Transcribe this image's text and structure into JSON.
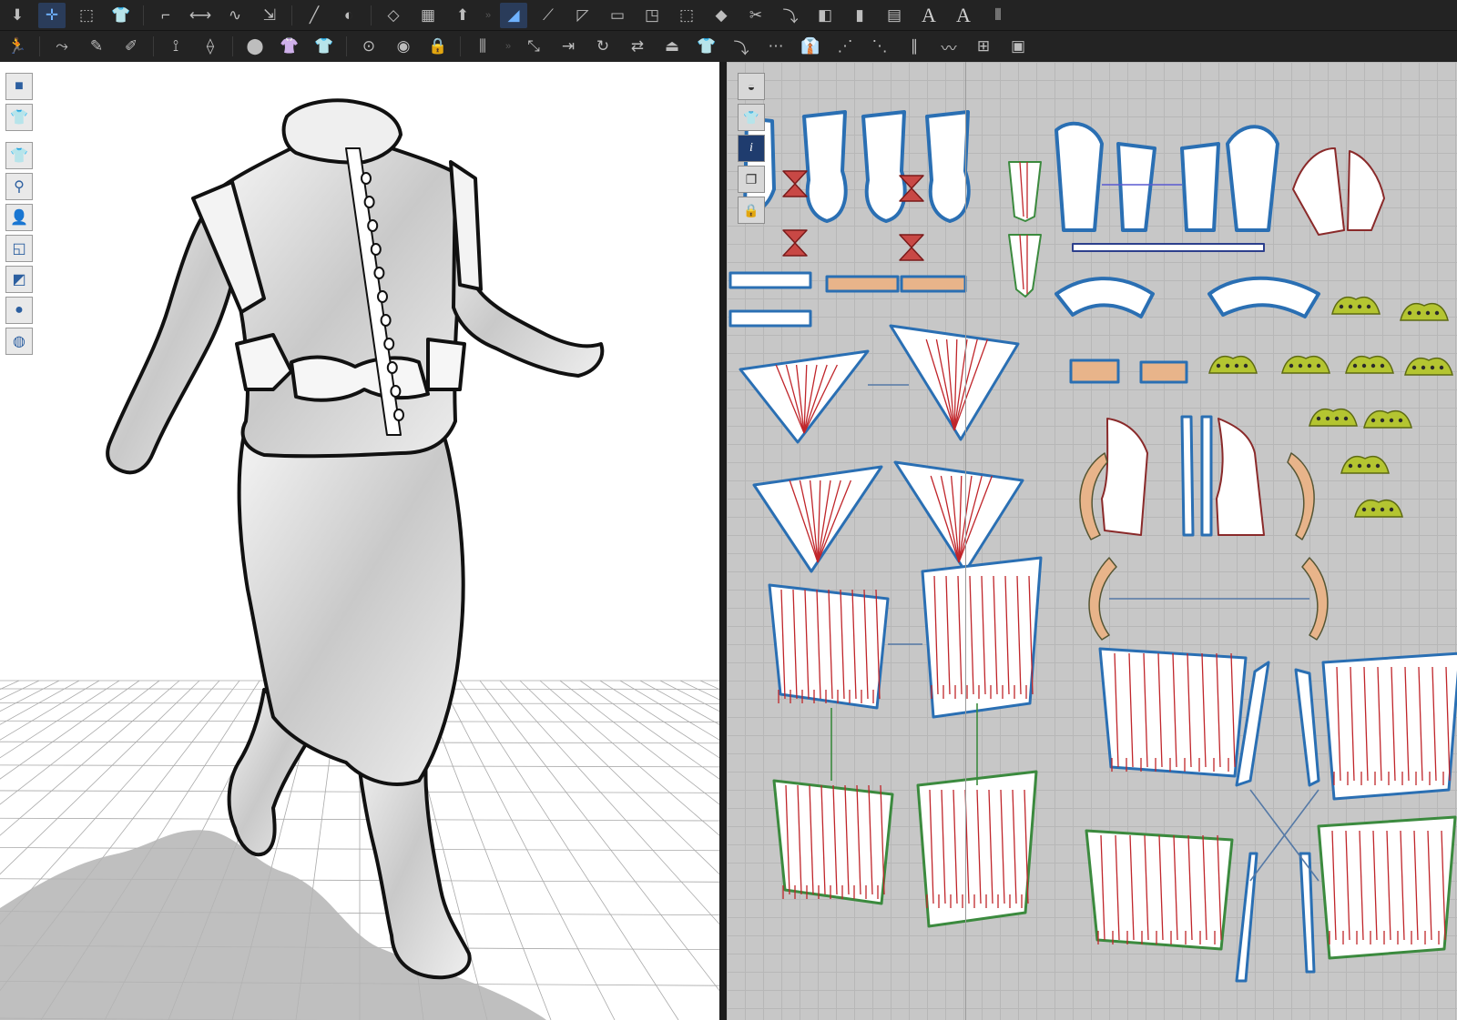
{
  "toolbar": {
    "row1": [
      {
        "name": "download-icon",
        "glyph": "⬇"
      },
      {
        "name": "move-icon",
        "glyph": "✛",
        "active": true
      },
      {
        "name": "select-icon",
        "glyph": "⬚"
      },
      {
        "name": "shirt-icon",
        "glyph": "👕"
      },
      {
        "sep": true
      },
      {
        "name": "segment-tool-icon",
        "glyph": "⌐"
      },
      {
        "name": "measure-icon",
        "glyph": "⟷"
      },
      {
        "name": "curve-icon",
        "glyph": "∿"
      },
      {
        "name": "stretch-icon",
        "glyph": "⇲"
      },
      {
        "sep": true
      },
      {
        "name": "pin-icon",
        "glyph": "╱"
      },
      {
        "name": "spin-icon",
        "glyph": "◐"
      },
      {
        "sep": true
      },
      {
        "name": "select-pattern-icon",
        "glyph": "◇"
      },
      {
        "name": "shirt-layout-icon",
        "glyph": "▦"
      },
      {
        "name": "arrange-icon",
        "glyph": "⬆"
      },
      {
        "gap": "»"
      },
      {
        "name": "fill-select-icon",
        "glyph": "◢",
        "active": true
      },
      {
        "name": "node-edit-icon",
        "glyph": "⟋"
      },
      {
        "name": "polygon-icon",
        "glyph": "◸"
      },
      {
        "name": "rect-icon",
        "glyph": "▭"
      },
      {
        "name": "corner-icon",
        "glyph": "◳"
      },
      {
        "name": "dash-rect-icon",
        "glyph": "⬚"
      },
      {
        "name": "dart-icon",
        "glyph": "◆"
      },
      {
        "name": "cut-icon",
        "glyph": "✂"
      },
      {
        "name": "hook-icon",
        "glyph": "⤵"
      },
      {
        "name": "fold-icon",
        "glyph": "◧"
      },
      {
        "name": "ruler-icon",
        "glyph": "▮"
      },
      {
        "name": "grid-icon",
        "glyph": "▤"
      },
      {
        "name": "text-a-icon",
        "glyph": "A",
        "text": true
      },
      {
        "name": "text-a-italic-icon",
        "glyph": "A",
        "text": true
      },
      {
        "name": "lines-icon",
        "glyph": "⦀"
      }
    ],
    "row2": [
      {
        "name": "avatar-walk-icon",
        "glyph": "🏃"
      },
      {
        "sep": true
      },
      {
        "name": "sewing-1-icon",
        "glyph": "⤳"
      },
      {
        "name": "sewing-2-icon",
        "glyph": "✎"
      },
      {
        "name": "sewing-3-icon",
        "glyph": "✐"
      },
      {
        "sep": true
      },
      {
        "name": "tack-icon",
        "glyph": "⟟"
      },
      {
        "name": "tack-2-icon",
        "glyph": "⟠"
      },
      {
        "sep": true
      },
      {
        "name": "button-tool-icon",
        "glyph": "⬤"
      },
      {
        "name": "shirt-tack-icon",
        "glyph": "👚"
      },
      {
        "name": "shirt-2-icon",
        "glyph": "👕"
      },
      {
        "sep": true
      },
      {
        "name": "button-select-icon",
        "glyph": "⊙"
      },
      {
        "name": "button-icon",
        "glyph": "◉"
      },
      {
        "name": "lock-icon",
        "glyph": "🔒"
      },
      {
        "sep": true
      },
      {
        "name": "zipper-icon",
        "glyph": "⫼"
      },
      {
        "gap": "»"
      },
      {
        "name": "transform-icon",
        "glyph": "⤡"
      },
      {
        "name": "align-icon",
        "glyph": "⇥"
      },
      {
        "name": "rotate-icon",
        "glyph": "↻"
      },
      {
        "name": "flip-icon",
        "glyph": "⇄"
      },
      {
        "name": "iron-icon",
        "glyph": "⏏"
      },
      {
        "name": "shirt-3-icon",
        "glyph": "👕"
      },
      {
        "name": "fold-arrange-icon",
        "glyph": "⤵"
      },
      {
        "name": "seam-line-icon",
        "glyph": "⋯"
      },
      {
        "name": "shirt-4-icon",
        "glyph": "👔"
      },
      {
        "name": "topstitch-icon",
        "glyph": "⋰"
      },
      {
        "name": "topstitch-2-icon",
        "glyph": "⋱"
      },
      {
        "name": "elastic-icon",
        "glyph": "∥"
      },
      {
        "name": "wave-icon",
        "glyph": "〰"
      },
      {
        "name": "puckering-icon",
        "glyph": "⊞"
      },
      {
        "name": "gift-icon",
        "glyph": "▣"
      }
    ]
  },
  "side_tools": [
    {
      "name": "cube-icon",
      "glyph": "■"
    },
    {
      "name": "garment-view-icon",
      "glyph": "👕"
    },
    {
      "gap": true
    },
    {
      "name": "shirt-display-icon",
      "glyph": "👕"
    },
    {
      "name": "avatar-skeleton-icon",
      "glyph": "⚲"
    },
    {
      "name": "avatar-icon",
      "glyph": "👤"
    },
    {
      "name": "texture-icon",
      "glyph": "◱"
    },
    {
      "name": "shape-icon",
      "glyph": "◩"
    },
    {
      "name": "avatar-orange-icon",
      "glyph": "●"
    },
    {
      "name": "globe-icon",
      "glyph": "◍"
    }
  ],
  "pattern_tools": [
    {
      "name": "eye-icon",
      "glyph": "◒"
    },
    {
      "name": "shirt-pattern-icon",
      "glyph": "👕"
    },
    {
      "name": "info-icon",
      "glyph": "i"
    },
    {
      "name": "pages-icon",
      "glyph": "❐"
    },
    {
      "name": "lock-pattern-icon",
      "glyph": "🔒"
    }
  ],
  "colors": {
    "accent": "#2e7dd1",
    "seam_blue": "#2a6fb3",
    "seam_red": "#c0252a",
    "seam_green": "#3b8a3e",
    "piece_fill": "#ffffff",
    "beige": "#e8b48a",
    "yellow_green": "#b4c531"
  }
}
